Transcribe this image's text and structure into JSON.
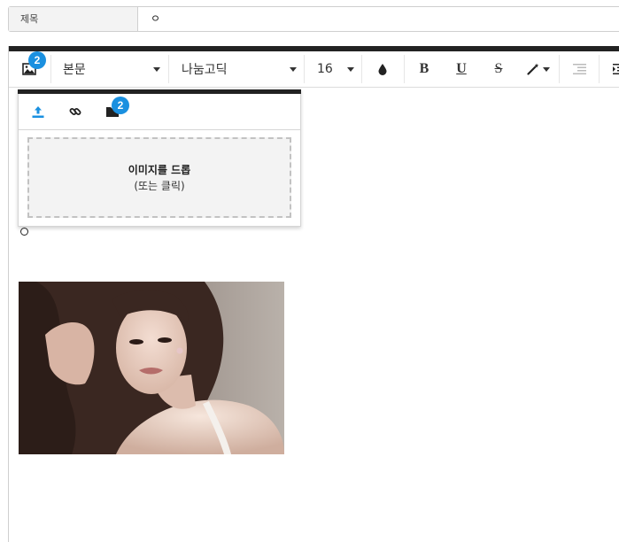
{
  "title_row": {
    "label": "제목",
    "value": "ㅇ"
  },
  "toolbar": {
    "image_badge": "2",
    "paragraph_style": "본문",
    "font_family": "나눔고딕",
    "font_size": "16",
    "bold_label": "B",
    "underline_label": "U",
    "strike_label": "S",
    "icons": [
      "image-icon",
      "ink-drop-icon",
      "magic-wand-icon",
      "outdent-icon",
      "indent-icon"
    ]
  },
  "image_panel": {
    "tabs": [
      "upload-icon",
      "link-icon",
      "folder-icon"
    ],
    "folder_badge": "2",
    "drop_title": "이미지를 드롭",
    "drop_sub": "(또는 클릭)"
  },
  "colors": {
    "accent": "#1a90e0",
    "topbar": "#222222"
  }
}
